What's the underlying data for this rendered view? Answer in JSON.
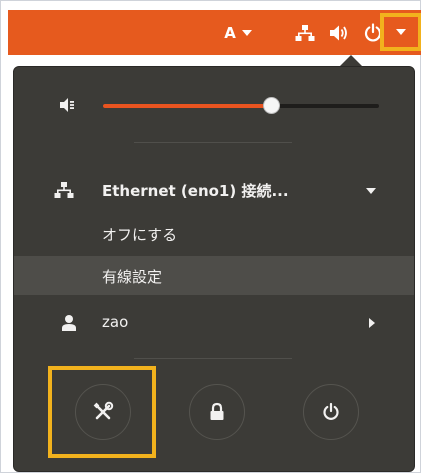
{
  "topbar": {
    "input_source_label": "A",
    "input_source_dropdown_icon": "caret-down-icon",
    "network_icon": "network-wired-icon",
    "volume_icon": "speaker-icon",
    "power_icon": "power-icon",
    "system_menu_icon": "caret-down-icon",
    "background_color": "#e65a1e",
    "highlight_color": "#f2b21d"
  },
  "menu": {
    "volume": {
      "icon": "speaker-low-icon",
      "level": 0.61
    },
    "ethernet": {
      "icon": "network-wired-icon",
      "label": "Ethernet (eno1) 接続...",
      "expand_icon": "caret-down-icon",
      "submenu": {
        "turn_off_label": "オフにする",
        "wired_settings_label": "有線設定"
      }
    },
    "user": {
      "icon": "person-icon",
      "name": "zao",
      "submenu_icon": "arrow-right-icon"
    },
    "actions": {
      "settings_icon": "tools-icon",
      "lock_icon": "lock-icon",
      "power_icon": "power-icon"
    },
    "background_color": "#3c3b37",
    "accent_color": "#e95420"
  }
}
